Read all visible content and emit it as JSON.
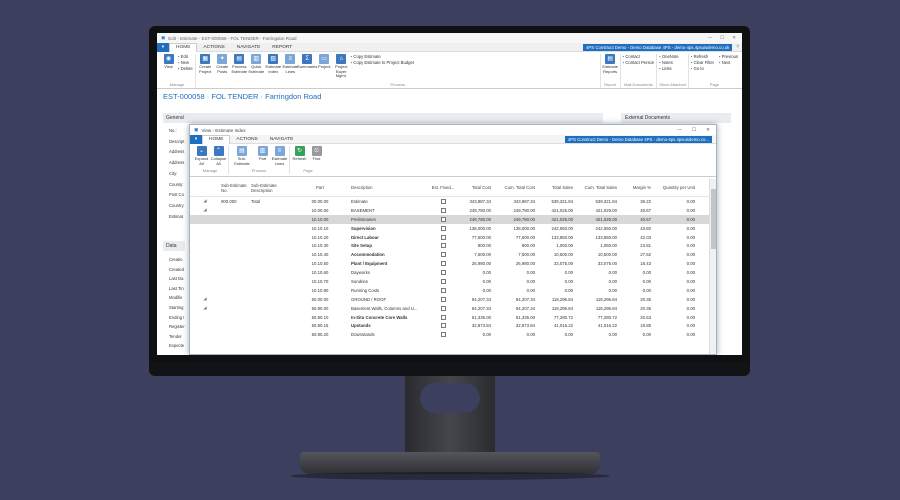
{
  "main": {
    "window_title": "Edit - Estimate - EST-000058 - FOL TENDER - Farringdon Road",
    "menu_tabs": [
      "HOME",
      "ACTIONS",
      "NAVIGATE",
      "REPORT"
    ],
    "company": "4PS Construct Demo - Demo Database 4PS - demo-4ps.4psuisdemo.co.uk",
    "ribbon": {
      "manage_caption": "Manage",
      "view": "View",
      "edit_list": [
        "Edit",
        "New",
        "Delete"
      ],
      "process_caption": "Process",
      "process_buttons": [
        "Create Project",
        "Create Posts",
        "Process Estimate",
        "Quick Estimate",
        "Estimate Index",
        "Estimate Lines",
        "Summaries",
        "Project",
        "Project Buyer Mgmt."
      ],
      "copy_list": [
        "Copy Estimate",
        "Copy Estimate to Project Budget"
      ],
      "report_caption": "Report",
      "reports": "Estimate Reports",
      "mail_caption": "Mail Documents",
      "mail_list": [
        "Contact",
        "Contact Person"
      ],
      "attached_caption": "Show Attached",
      "attached_list": [
        "OneNote",
        "Notes",
        "Links"
      ],
      "page_caption": "Page",
      "page_list_1": [
        "Refresh",
        "Clear Filter",
        "Go to"
      ],
      "page_list_2": [
        "Previous",
        "Next"
      ]
    },
    "page_title": "EST-000058 · FOL TENDER · Farringdon Road",
    "general_header": "General",
    "external_documents": "External Documents",
    "general_labels": [
      "No.:",
      "Descript",
      "Address",
      "Address",
      "City:",
      "County:",
      "Post Co",
      "Country",
      "Estimat"
    ],
    "data_header": "Data",
    "data_labels": [
      "Creatio",
      "Created",
      "Last Da",
      "Last Tin",
      "Modifie",
      "Starting",
      "Ending I",
      "Register",
      "Tender",
      "Expecte"
    ]
  },
  "child": {
    "window_title": "View - Estimate Index",
    "menu_tabs": [
      "HOME",
      "ACTIONS",
      "NAVIGATE"
    ],
    "company": "4PS Construct Demo - Demo Database 4PS - demo-4ps.4psuisdemo.co...",
    "ribbon": {
      "expand": "Expand All",
      "collapse": "Collapse All",
      "manage_caption": "Manage",
      "sub_estimate": "Sub-Estimate",
      "part": "Part",
      "estimate_lines": "Estimate Lines",
      "process_caption": "Process",
      "refresh": "Refresh",
      "find": "Find",
      "page_caption": "Page"
    },
    "columns": [
      "Sub-Estimate No.",
      "Sub-Estimate Description",
      "Part",
      "Description",
      "Est. Fixed...",
      "Total Cost",
      "Cum. Total Cost",
      "Total Sales",
      "Cum. Total Sales",
      "Margin %",
      "Quantity per Unit"
    ],
    "rows": [
      {
        "exp": "◢",
        "sub": "000.000",
        "subdesc": "Total",
        "part": "00.00.00",
        "desc": "Estimate",
        "bold": false,
        "tc": "343,987.34",
        "ctc": "343,987.34",
        "ts": "539,321.84",
        "cts": "539,321.84",
        "margin": "36.22",
        "qty": "0.00"
      },
      {
        "exp": "◢",
        "sub": "",
        "subdesc": "",
        "part": "10.00.00",
        "desc": "BASEMENT",
        "bold": false,
        "tc": "249,780.00",
        "ctc": "249,780.00",
        "ts": "421,025.00",
        "cts": "421,025.00",
        "margin": "40.67",
        "qty": "0.00"
      },
      {
        "exp": "",
        "sub": "",
        "subdesc": "",
        "part": "10.10.00",
        "desc": "Preliminaries",
        "bold": false,
        "tc": "249,780.00",
        "ctc": "249,780.00",
        "ts": "421,025.00",
        "cts": "421,025.00",
        "margin": "40.67",
        "qty": "0.00",
        "sel": true
      },
      {
        "exp": "",
        "sub": "",
        "subdesc": "",
        "part": "10.10.10",
        "desc": "Supervision",
        "bold": true,
        "tc": "138,000.00",
        "ctc": "138,000.00",
        "ts": "242,550.00",
        "cts": "242,550.00",
        "margin": "43.60",
        "qty": "0.00"
      },
      {
        "exp": "",
        "sub": "",
        "subdesc": "",
        "part": "10.10.20",
        "desc": "Direct Labour",
        "bold": true,
        "tc": "77,600.00",
        "ctc": "77,600.00",
        "ts": "133,850.00",
        "cts": "133,850.00",
        "margin": "42.03",
        "qty": "0.00"
      },
      {
        "exp": "",
        "sub": "",
        "subdesc": "",
        "part": "10.10.30",
        "desc": "Site Setup",
        "bold": true,
        "tc": "800.00",
        "ctc": "800.00",
        "ts": "1,050.00",
        "cts": "1,050.00",
        "margin": "23.81",
        "qty": "0.00"
      },
      {
        "exp": "",
        "sub": "",
        "subdesc": "",
        "part": "10.10.40",
        "desc": "Accommodation",
        "bold": true,
        "tc": "7,600.00",
        "ctc": "7,600.00",
        "ts": "10,500.00",
        "cts": "10,500.00",
        "margin": "27.62",
        "qty": "0.00"
      },
      {
        "exp": "",
        "sub": "",
        "subdesc": "",
        "part": "10.10.50",
        "desc": "Plant / Equipment",
        "bold": true,
        "tc": "26,980.00",
        "ctc": "26,980.00",
        "ts": "33,075.00",
        "cts": "33,075.00",
        "margin": "18.43",
        "qty": "0.00"
      },
      {
        "exp": "",
        "sub": "",
        "subdesc": "",
        "part": "10.10.60",
        "desc": "Dayworks",
        "bold": false,
        "tc": "0.00",
        "ctc": "0.00",
        "ts": "0.00",
        "cts": "0.00",
        "margin": "0.00",
        "qty": "0.00"
      },
      {
        "exp": "",
        "sub": "",
        "subdesc": "",
        "part": "10.10.70",
        "desc": "Sundries",
        "bold": false,
        "tc": "0.00",
        "ctc": "0.00",
        "ts": "0.00",
        "cts": "0.00",
        "margin": "0.00",
        "qty": "0.00"
      },
      {
        "exp": "",
        "sub": "",
        "subdesc": "",
        "part": "10.10.80",
        "desc": "Running Costs",
        "bold": false,
        "tc": "0.00",
        "ctc": "0.00",
        "ts": "0.00",
        "cts": "0.00",
        "margin": "0.00",
        "qty": "0.00"
      },
      {
        "exp": "◢",
        "sub": "",
        "subdesc": "",
        "part": "50.00.00",
        "desc": "GROUND / ROOF",
        "bold": false,
        "tc": "94,207.34",
        "ctc": "94,207.34",
        "ts": "118,296.84",
        "cts": "118,296.84",
        "margin": "20.36",
        "qty": "0.00"
      },
      {
        "exp": "◢",
        "sub": "",
        "subdesc": "",
        "part": "50.80.00",
        "desc": "Basement Walls, Columns and U...",
        "bold": false,
        "tc": "94,207.34",
        "ctc": "94,207.34",
        "ts": "118,296.84",
        "cts": "118,296.84",
        "margin": "20.36",
        "qty": "0.00"
      },
      {
        "exp": "",
        "sub": "",
        "subdesc": "",
        "part": "50.80.10",
        "desc": "In-Situ Concrete Core Walls",
        "bold": true,
        "tc": "61,335.00",
        "ctc": "61,335.00",
        "ts": "77,280.72",
        "cts": "77,280.72",
        "margin": "20.63",
        "qty": "0.00"
      },
      {
        "exp": "",
        "sub": "",
        "subdesc": "",
        "part": "50.80.15",
        "desc": "Upstands",
        "bold": true,
        "tc": "32,873.84",
        "ctc": "32,873.84",
        "ts": "41,016.22",
        "cts": "41,016.22",
        "margin": "19.85",
        "qty": "0.00"
      },
      {
        "exp": "",
        "sub": "",
        "subdesc": "",
        "part": "50.80.20",
        "desc": "Downstands",
        "bold": false,
        "tc": "0.00",
        "ctc": "0.00",
        "ts": "0.00",
        "cts": "0.00",
        "margin": "0.00",
        "qty": "0.00"
      }
    ]
  }
}
